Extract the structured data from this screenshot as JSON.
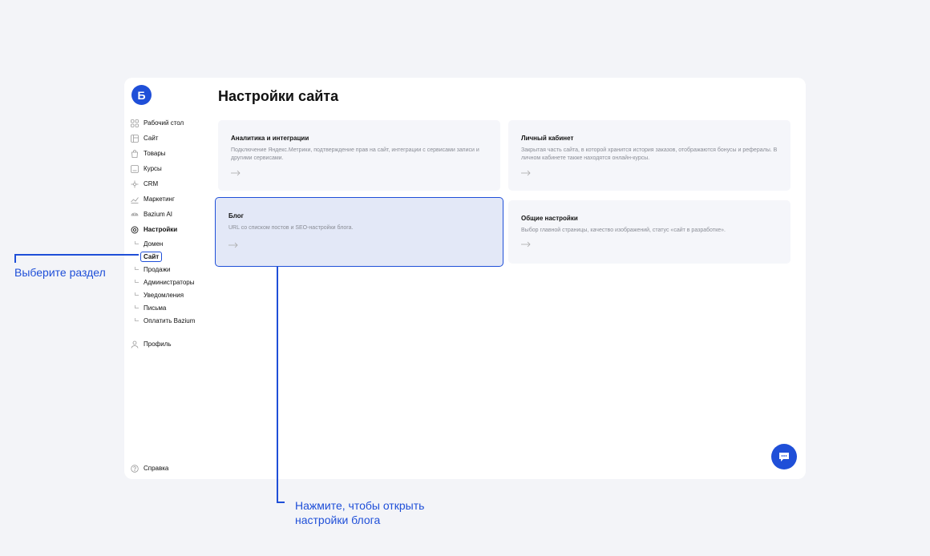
{
  "app": {
    "logo_letter": "Б",
    "page_title": "Настройки сайта"
  },
  "sidebar": {
    "items": [
      {
        "label": "Рабочий стол",
        "icon": "dashboard-icon"
      },
      {
        "label": "Сайт",
        "icon": "site-icon"
      },
      {
        "label": "Товары",
        "icon": "bag-icon"
      },
      {
        "label": "Курсы",
        "icon": "courses-icon"
      },
      {
        "label": "CRM",
        "icon": "crm-icon"
      },
      {
        "label": "Маркетинг",
        "icon": "chart-icon"
      },
      {
        "label": "Bazium AI",
        "icon": "ai-icon"
      },
      {
        "label": "Настройки",
        "icon": "gear-icon"
      }
    ],
    "sub_items": [
      "Домен",
      "Сайт",
      "Продажи",
      "Администраторы",
      "Уведомления",
      "Письма",
      "Оплатить Bazium"
    ],
    "profile": "Профиль",
    "help": "Справка"
  },
  "cards": [
    {
      "title": "Аналитика и интеграции",
      "desc": "Подключение Яндекс.Метрики, подтверждение прав на сайт, интеграции с сервисами записи и другими сервисами."
    },
    {
      "title": "Личный кабинет",
      "desc": "Закрытая часть сайта, в которой хранится история заказов, отображаются бонусы и рефералы. В личном кабинете также находятся онлайн-курсы."
    },
    {
      "title": "Блог",
      "desc": "URL со списком постов и SEO-настройки блога."
    },
    {
      "title": "Общие настройки",
      "desc": "Выбор главной страницы, качество изображений, статус «сайт в разработке»."
    }
  ],
  "annotations": {
    "left": "Выберите раздел",
    "bottom_line1": "Нажмите, чтобы открыть",
    "bottom_line2": "настройки блога"
  },
  "colors": {
    "accent": "#1f4fd8",
    "card_bg": "#f5f6fa",
    "highlight_bg": "#e3e8f7",
    "page_bg": "#f3f4f8"
  }
}
